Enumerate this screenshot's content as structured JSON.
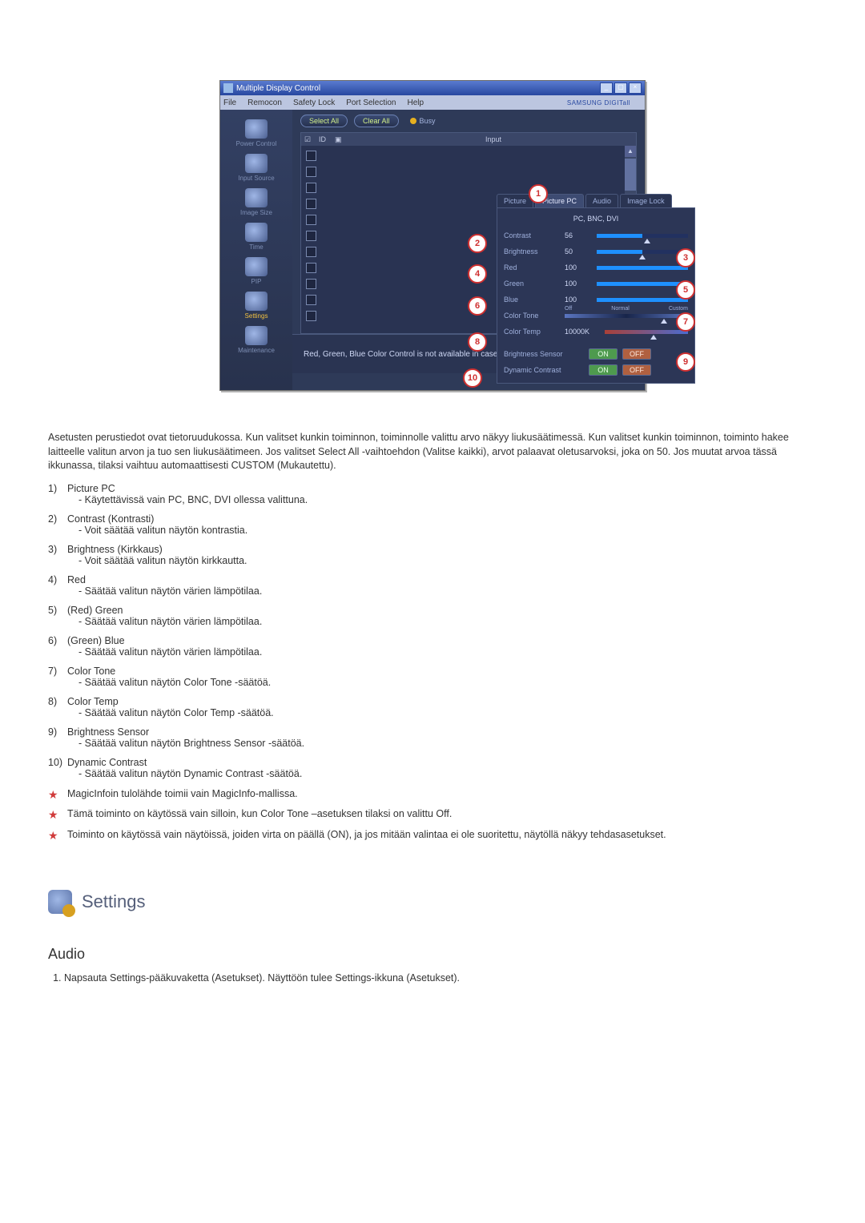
{
  "app": {
    "title": "Multiple Display Control",
    "menu": [
      "File",
      "Remocon",
      "Safety Lock",
      "Port Selection",
      "Help"
    ],
    "brand": "SAMSUNG DIGITall"
  },
  "sidebar": {
    "items": [
      {
        "label": "Power Control"
      },
      {
        "label": "Input Source"
      },
      {
        "label": "Image Size"
      },
      {
        "label": "Time"
      },
      {
        "label": "PIP"
      },
      {
        "label": "Settings"
      },
      {
        "label": "Maintenance"
      }
    ]
  },
  "buttons": {
    "select_all": "Select All",
    "clear_all": "Clear All",
    "busy": "Busy"
  },
  "listheader": {
    "id": "ID",
    "input": "Input"
  },
  "tabs": {
    "picture": "Picture",
    "picture_pc": "Picture PC",
    "audio": "Audio",
    "image_lock": "Image Lock"
  },
  "panel": {
    "subheader": "PC, BNC, DVI",
    "contrast": {
      "label": "Contrast",
      "value": "56"
    },
    "brightness": {
      "label": "Brightness",
      "value": "50"
    },
    "red": {
      "label": "Red",
      "value": "100"
    },
    "green": {
      "label": "Green",
      "value": "100"
    },
    "blue": {
      "label": "Blue",
      "value": "100"
    },
    "color_tone": {
      "label": "Color Tone",
      "opts": [
        "Off",
        "Normal",
        "Custom"
      ]
    },
    "color_temp": {
      "label": "Color Temp",
      "value": "10000K"
    },
    "brightness_sensor": {
      "label": "Brightness Sensor"
    },
    "dynamic_contrast": {
      "label": "Dynamic Contrast"
    },
    "on": "ON",
    "off": "OFF"
  },
  "footer_note": "Red, Green, Blue Color Control is not available in case of DVI Source.",
  "callouts": [
    "1",
    "2",
    "3",
    "4",
    "5",
    "6",
    "7",
    "8",
    "9",
    "10"
  ],
  "description": {
    "intro": "Asetusten perustiedot ovat tietoruudukossa. Kun valitset kunkin toiminnon, toiminnolle valittu arvo näkyy liukusäätimessä. Kun valitset kunkin toiminnon, toiminto hakee laitteelle valitun arvon ja tuo sen liukusäätimeen. Jos valitset Select All -vaihtoehdon (Valitse kaikki), arvot palaavat oletusarvoksi, joka on 50. Jos muutat arvoa tässä ikkunassa, tilaksi vaihtuu automaattisesti CUSTOM (Mukautettu).",
    "items": [
      {
        "title": "Picture PC",
        "sub": "- Käytettävissä vain PC, BNC, DVI ollessa valittuna."
      },
      {
        "title": "Contrast (Kontrasti)",
        "sub": "- Voit säätää valitun näytön kontrastia."
      },
      {
        "title": "Brightness (Kirkkaus)",
        "sub": "- Voit säätää valitun näytön kirkkautta."
      },
      {
        "title": "Red",
        "sub": "- Säätää valitun näytön värien lämpötilaa."
      },
      {
        "title": "(Red) Green",
        "sub": "- Säätää valitun näytön värien lämpötilaa."
      },
      {
        "title": "(Green) Blue",
        "sub": "- Säätää valitun näytön värien lämpötilaa."
      },
      {
        "title": "Color Tone",
        "sub": "- Säätää valitun näytön Color Tone -säätöä."
      },
      {
        "title": "Color Temp",
        "sub": "- Säätää valitun näytön Color Temp -säätöä."
      },
      {
        "title": "Brightness Sensor",
        "sub": "- Säätää valitun näytön Brightness Sensor -säätöä."
      },
      {
        "title": "Dynamic Contrast",
        "sub": "- Säätää valitun näytön Dynamic Contrast -säätöä."
      }
    ],
    "stars": [
      "MagicInfoin tulolähde toimii vain MagicInfo-mallissa.",
      "Tämä toiminto on käytössä vain silloin, kun Color Tone –asetuksen tilaksi on valittu Off.",
      "Toiminto on käytössä vain näytöissä, joiden virta on päällä (ON), ja jos mitään valintaa ei ole suoritettu, näytöllä näkyy tehdasasetukset."
    ]
  },
  "section": {
    "settings": "Settings",
    "audio": "Audio"
  },
  "steps": {
    "s1": "Napsauta Settings-pääkuvaketta (Asetukset). Näyttöön tulee Settings-ikkuna (Asetukset)."
  }
}
